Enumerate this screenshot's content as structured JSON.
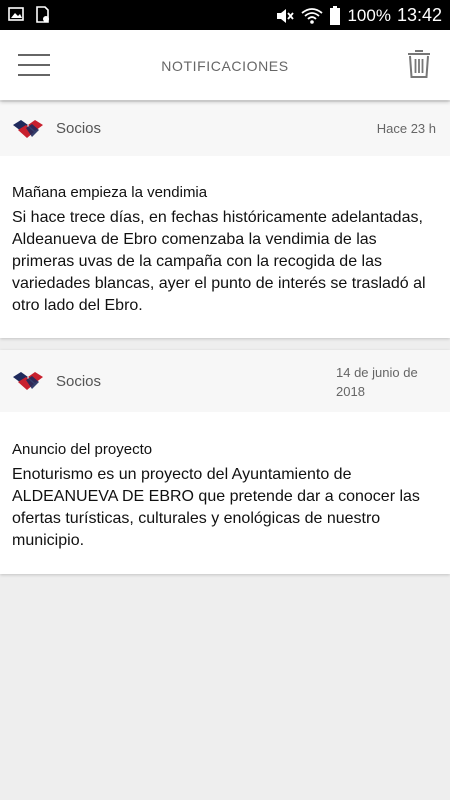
{
  "status_bar": {
    "left_icons": [
      "image-icon",
      "sim-manager-icon"
    ],
    "right_icons": [
      "mute-icon",
      "wifi-icon",
      "battery-icon"
    ],
    "battery": "100%",
    "time": "13:42"
  },
  "header": {
    "title": "NOTIFICACIONES",
    "menu_icon": "hamburger-menu-icon",
    "delete_icon": "trash-icon"
  },
  "notifications": [
    {
      "source": "Socios",
      "date": "Hace 23 h",
      "title": "Mañana empieza la vendimia",
      "text": "Si hace trece días, en fechas históricamente adelantadas, Aldeanueva de Ebro comenzaba la vendimia de las primeras uvas de la campaña con la recogida de las variedades blancas, ayer el punto de interés se trasladó al otro lado del Ebro."
    },
    {
      "source": "Socios",
      "date": "14 de junio de 2018",
      "title": "Anuncio del proyecto",
      "text": "Enoturismo es un proyecto del Ayuntamiento de ALDEANUEVA DE EBRO que pretende dar a conocer las ofertas turísticas, culturales y enológicas de nuestro municipio."
    }
  ],
  "colors": {
    "logo_red": "#c8202e",
    "logo_navy": "#1f2a5c",
    "header_bg": "#ffffff",
    "card_header_bg": "#f7f7f7",
    "page_bg": "#eeeeee"
  }
}
